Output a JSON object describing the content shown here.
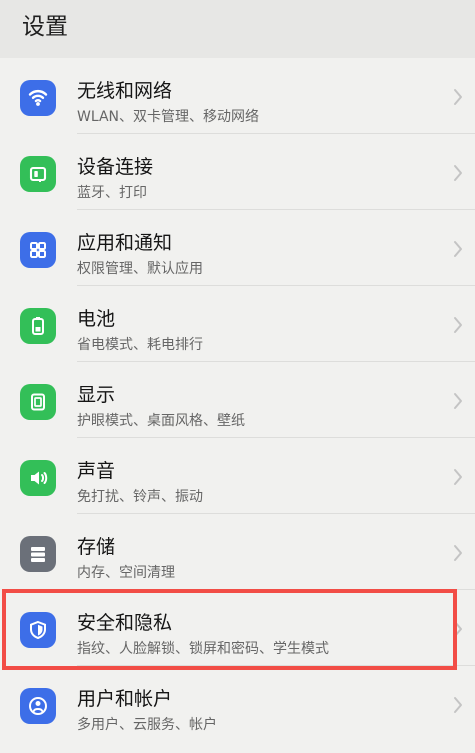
{
  "header": {
    "title": "设置"
  },
  "settings": {
    "items": [
      {
        "title": "无线和网络",
        "subtitle": "WLAN、双卡管理、移动网络"
      },
      {
        "title": "设备连接",
        "subtitle": "蓝牙、打印"
      },
      {
        "title": "应用和通知",
        "subtitle": "权限管理、默认应用"
      },
      {
        "title": "电池",
        "subtitle": "省电模式、耗电排行"
      },
      {
        "title": "显示",
        "subtitle": "护眼模式、桌面风格、壁纸"
      },
      {
        "title": "声音",
        "subtitle": "免打扰、铃声、振动"
      },
      {
        "title": "存储",
        "subtitle": "内存、空间清理"
      },
      {
        "title": "安全和隐私",
        "subtitle": "指纹、人脸解锁、锁屏和密码、学生模式"
      },
      {
        "title": "用户和帐户",
        "subtitle": "多用户、云服务、帐户"
      }
    ]
  },
  "colors": {
    "blue": "#3d6ee8",
    "green": "#33bf58",
    "gray": "#6b7079",
    "highlight": "#f24d46"
  },
  "icons": {
    "wifi": "wifi-icon",
    "device": "device-connection-icon",
    "apps": "apps-icon",
    "battery": "battery-icon",
    "display": "display-icon",
    "sound": "sound-icon",
    "storage": "storage-icon",
    "security": "shield-icon",
    "users": "user-icon"
  }
}
